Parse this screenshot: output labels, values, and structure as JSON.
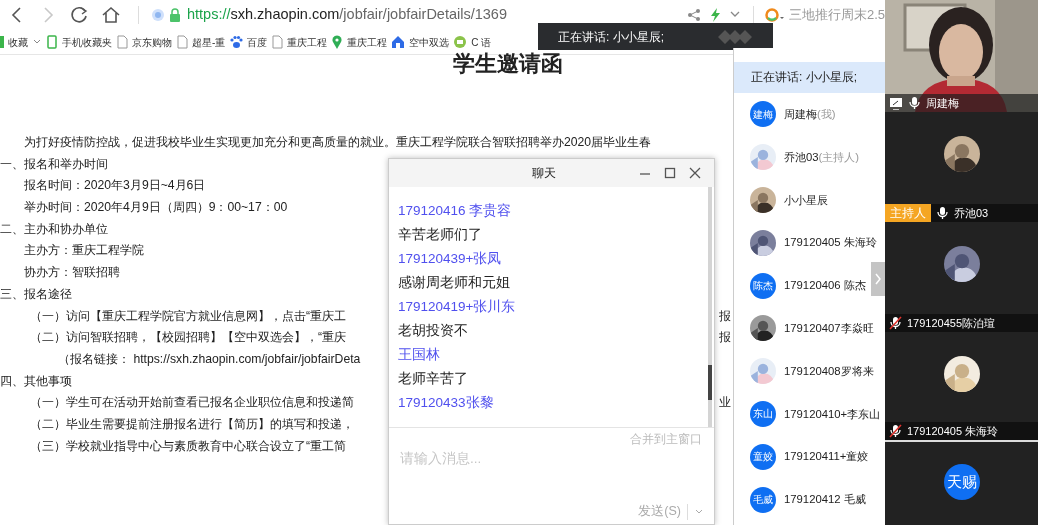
{
  "browser": {
    "nav_buttons": [
      {
        "kind": "back",
        "disabled": false
      },
      {
        "kind": "forward",
        "disabled": true
      },
      {
        "kind": "reload",
        "disabled": false
      },
      {
        "kind": "home",
        "disabled": false
      }
    ],
    "url": {
      "scheme": "https://",
      "host": "sxh.zhaopin.com",
      "path": "/jobfair/jobfairDetails/1369"
    },
    "search_text": "三地推行周末2.5",
    "bookmarks": [
      {
        "kind": "folder",
        "label": "收藏"
      },
      {
        "kind": "phone",
        "label": "手机收藏夹"
      },
      {
        "kind": "page",
        "label": "京东购物"
      },
      {
        "kind": "page",
        "label": "超星-重"
      },
      {
        "kind": "paw",
        "label": "百度"
      },
      {
        "kind": "page",
        "label": "重庆工程"
      },
      {
        "kind": "pin",
        "label": "重庆工程"
      },
      {
        "kind": "house",
        "label": "空中双选"
      },
      {
        "kind": "round",
        "label": "C 语"
      }
    ]
  },
  "page": {
    "title": "学生邀请函",
    "lines": [
      {
        "kind": "intro",
        "text": "为打好疫情防控战，促进我校毕业生实现更加充分和更高质量的就业。重庆工程学院联合智联招聘举办2020届毕业生春"
      },
      {
        "kind": "heading",
        "text": "一、报名和举办时间"
      },
      {
        "kind": "item",
        "text": "报名时间：2020年3月9日~4月6日"
      },
      {
        "kind": "item",
        "text": "举办时间：2020年4月9日（周四）9：00~17：00"
      },
      {
        "kind": "heading",
        "text": "二、主办和协办单位"
      },
      {
        "kind": "item",
        "text": "主办方：重庆工程学院"
      },
      {
        "kind": "item",
        "text": "协办方：智联招聘"
      },
      {
        "kind": "heading",
        "text": "三、报名途径"
      },
      {
        "kind": "sub",
        "text": "（一）访问【重庆工程学院官方就业信息网】，点击“重庆工",
        "right_fragment": "报"
      },
      {
        "kind": "sub",
        "text": "（二）访问智联招聘，【校园招聘】【空中双选会】，“重庆",
        "right_fragment": "报"
      },
      {
        "kind": "link",
        "text": "（报名链接： https://sxh.zhaopin.com/jobfair/jobfairDeta"
      },
      {
        "kind": "heading",
        "text": "四、其他事项"
      },
      {
        "kind": "sub",
        "text": "（一）学生可在活动开始前查看已报名企业职位信息和投递简",
        "right_fragment": "业"
      },
      {
        "kind": "sub",
        "text": "（二）毕业生需要提前注册报名进行【简历】的填写和投递，"
      },
      {
        "kind": "sub",
        "text": "（三）学校就业指导中心与素质教育中心联合设立了“重工简"
      }
    ]
  },
  "chat": {
    "title": "聊天",
    "messages": [
      {
        "sender": "179120416 李贵容",
        "text": "辛苦老师们了"
      },
      {
        "sender": "179120439+张凤",
        "text": "感谢周老师和元姐"
      },
      {
        "sender": "179120419+张川东",
        "text": "老胡投资不"
      },
      {
        "sender": "王国林",
        "text": "老师辛苦了"
      },
      {
        "sender": "179120433张黎"
      }
    ],
    "merge_link": "合并到主窗口",
    "input": {
      "placeholder": "请输入消息..."
    },
    "send_button": "发送(S)"
  },
  "speaking_toast": {
    "text": "正在讲话: 小小星辰;"
  },
  "participants": {
    "speaking": "正在讲话: 小小星辰;",
    "items": [
      {
        "name": "周建梅",
        "note": "(我)",
        "avatar": {
          "kind": "initials",
          "text": "建梅"
        }
      },
      {
        "name": "乔池03",
        "note": "(主持人)"
      },
      {
        "name": "小小星辰"
      },
      {
        "name": " 179120405 朱海玲"
      },
      {
        "name": "179120406 陈杰",
        "avatar": {
          "kind": "initials",
          "text": "陈杰"
        }
      },
      {
        "name": "179120407李焱旺"
      },
      {
        "name": "179120408罗将来"
      },
      {
        "name": "179120410+李东山",
        "avatar": {
          "kind": "initials",
          "text": "东山"
        }
      },
      {
        "name": "179120411+童姣",
        "avatar": {
          "kind": "initials",
          "text": "童姣"
        }
      },
      {
        "name": "179120412 毛威",
        "avatar": {
          "kind": "initials",
          "text": "毛威"
        }
      }
    ]
  },
  "video_tiles": [
    {
      "kind": "video",
      "name": "周建梅",
      "muted": false,
      "screen": true
    },
    {
      "kind": "picture",
      "name": "乔池03",
      "muted": false,
      "host_badge": "主持人"
    },
    {
      "kind": "picture",
      "name": "179120455陈泊瑄",
      "muted": true
    },
    {
      "kind": "picture",
      "name": "179120405 朱海玲",
      "muted": true
    },
    {
      "kind": "initials",
      "avatar_text": "天赐"
    }
  ]
}
